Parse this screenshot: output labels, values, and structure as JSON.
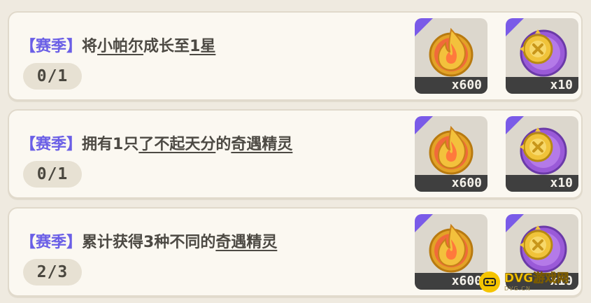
{
  "quests": [
    {
      "tag": "【赛季】",
      "segments": [
        {
          "text": "将",
          "hl": false
        },
        {
          "text": "小帕尔",
          "hl": true
        },
        {
          "text": "成长至",
          "hl": false
        },
        {
          "text": "1星",
          "hl": true
        }
      ],
      "progress": "0/1",
      "rewards": [
        {
          "icon": "fire-coin-icon",
          "qty": "x600"
        },
        {
          "icon": "purple-medal-icon",
          "qty": "x10"
        }
      ]
    },
    {
      "tag": "【赛季】",
      "segments": [
        {
          "text": "拥有1只",
          "hl": false
        },
        {
          "text": "了不起天分",
          "hl": true
        },
        {
          "text": "的",
          "hl": false
        },
        {
          "text": "奇遇精灵",
          "hl": true
        }
      ],
      "progress": "0/1",
      "rewards": [
        {
          "icon": "fire-coin-icon",
          "qty": "x600"
        },
        {
          "icon": "purple-medal-icon",
          "qty": "x10"
        }
      ]
    },
    {
      "tag": "【赛季】",
      "segments": [
        {
          "text": "累计获得3种不同的",
          "hl": false
        },
        {
          "text": "奇遇精灵",
          "hl": true
        }
      ],
      "progress": "2/3",
      "rewards": [
        {
          "icon": "fire-coin-icon",
          "qty": "x600"
        },
        {
          "icon": "purple-medal-icon",
          "qty": "x10"
        }
      ]
    }
  ],
  "watermark": {
    "main": "DVG游戏网",
    "sub": "DVG.CN"
  },
  "colors": {
    "tag": "#6a5ee6",
    "card_bg": "#fbf8f1",
    "qty_bar": "#3f3f3f",
    "corner": "#7a5be8"
  }
}
